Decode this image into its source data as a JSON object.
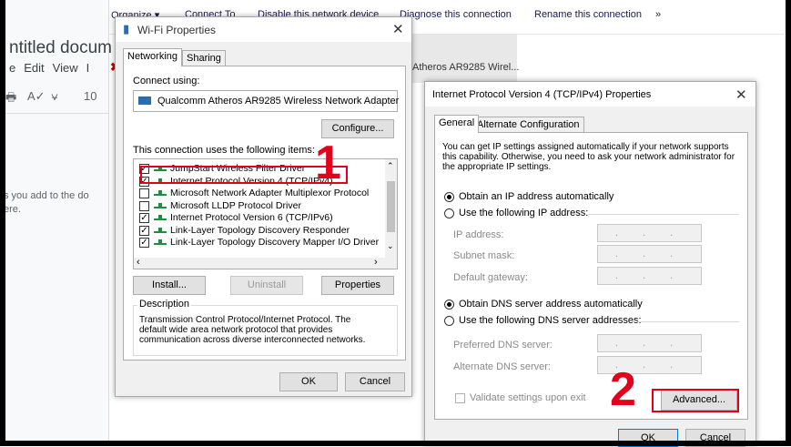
{
  "docs": {
    "title_fragment": "ntitled docum",
    "menu": [
      "e",
      "Edit",
      "View",
      "I"
    ],
    "toolbar_zoom_fragment": "10",
    "body_text_line1": "s you add to the do",
    "body_text_line2": "ere."
  },
  "network": {
    "commands": [
      "Organize ▾",
      "Connect To",
      "Disable this network device",
      "Diagnose this connection",
      "Rename this connection",
      "»"
    ],
    "adapter_label": "Atheros AR9285 Wirel..."
  },
  "wifi": {
    "title": "Wi-Fi Properties",
    "tabs": [
      "Networking",
      "Sharing"
    ],
    "connect_using_label": "Connect using:",
    "adapter_name": "Qualcomm Atheros AR9285 Wireless Network Adapter",
    "configure_label": "Configure...",
    "items_label": "This connection uses the following items:",
    "items": [
      {
        "label": "JumpStart Wireless Filter Driver",
        "checked": true
      },
      {
        "label": "Internet Protocol Version 4 (TCP/IPv4)",
        "checked": true
      },
      {
        "label": "Microsoft Network Adapter Multiplexor Protocol",
        "checked": false
      },
      {
        "label": "Microsoft LLDP Protocol Driver",
        "checked": false
      },
      {
        "label": "Internet Protocol Version 6 (TCP/IPv6)",
        "checked": true
      },
      {
        "label": "Link-Layer Topology Discovery Responder",
        "checked": true
      },
      {
        "label": "Link-Layer Topology Discovery Mapper I/O Driver",
        "checked": true
      }
    ],
    "install_label": "Install...",
    "uninstall_label": "Uninstall",
    "properties_label": "Properties",
    "description_title": "Description",
    "description_text": "Transmission Control Protocol/Internet Protocol. The default wide area network protocol that provides communication across diverse interconnected networks.",
    "ok_label": "OK",
    "cancel_label": "Cancel"
  },
  "ipv4": {
    "title": "Internet Protocol Version 4 (TCP/IPv4) Properties",
    "tabs": [
      "General",
      "Alternate Configuration"
    ],
    "intro_text": "You can get IP settings assigned automatically if your network supports this capability. Otherwise, you need to ask your network administrator for the appropriate IP settings.",
    "obtain_ip_label": "Obtain an IP address automatically",
    "use_ip_label": "Use the following IP address:",
    "ip_address_label": "IP address:",
    "subnet_label": "Subnet mask:",
    "gateway_label": "Default gateway:",
    "obtain_dns_label": "Obtain DNS server address automatically",
    "use_dns_label": "Use the following DNS server addresses:",
    "preferred_dns_label": "Preferred DNS server:",
    "alternate_dns_label": "Alternate DNS server:",
    "ip_placeholder": ". . .",
    "validate_label": "Validate settings upon exit",
    "advanced_label": "Advanced...",
    "ok_label": "OK",
    "cancel_label": "Cancel"
  },
  "annotations": {
    "step1": "1",
    "step2": "2",
    "color": "#e3001b"
  }
}
